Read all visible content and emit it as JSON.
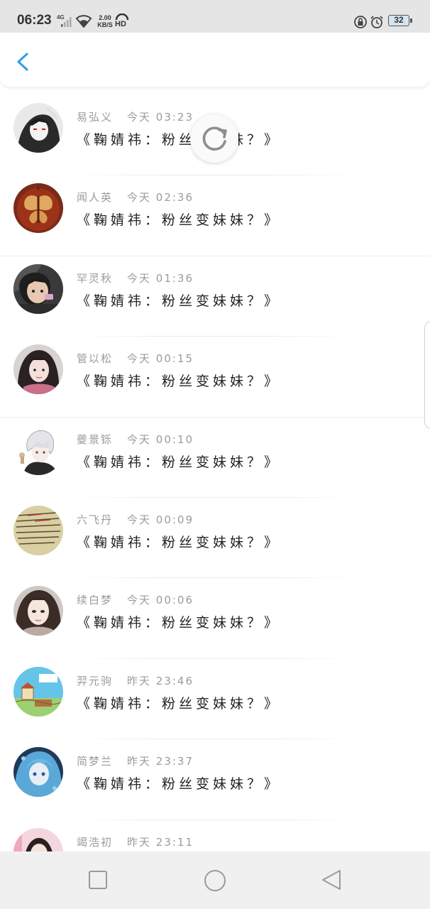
{
  "status_bar": {
    "time": "06:23",
    "network_label": "4G",
    "speed_value": "2.00",
    "speed_unit": "KB/S",
    "hd_label": "HD",
    "battery": "32"
  },
  "header": {
    "back_icon": "chevron-left-icon",
    "accent_color": "#2aa0e8"
  },
  "refresh": {
    "icon": "refresh-icon"
  },
  "comments": [
    {
      "name": "易弘义",
      "time": "今天 03:23",
      "text": "《鞠婧祎：粉丝变妹妹？》",
      "avatar": "avatar-1"
    },
    {
      "name": "闻人英",
      "time": "今天 02:36",
      "text": "《鞠婧祎：粉丝变妹妹？》",
      "avatar": "avatar-2"
    },
    {
      "name": "罕灵秋",
      "time": "今天 01:36",
      "text": "《鞠婧祎：粉丝变妹妹？》",
      "avatar": "avatar-3"
    },
    {
      "name": "管以松",
      "time": "今天 00:15",
      "text": "《鞠婧祎：粉丝变妹妹？》",
      "avatar": "avatar-4"
    },
    {
      "name": "夔景铄",
      "time": "今天 00:10",
      "text": "《鞠婧祎：粉丝变妹妹？》",
      "avatar": "avatar-5"
    },
    {
      "name": "六飞丹",
      "time": "今天 00:09",
      "text": "《鞠婧祎：粉丝变妹妹？》",
      "avatar": "avatar-6"
    },
    {
      "name": "续白梦",
      "time": "今天 00:06",
      "text": "《鞠婧祎：粉丝变妹妹？》",
      "avatar": "avatar-7"
    },
    {
      "name": "羿元驹",
      "time": "昨天 23:46",
      "text": "《鞠婧祎：粉丝变妹妹？》",
      "avatar": "avatar-8"
    },
    {
      "name": "简梦兰",
      "time": "昨天 23:37",
      "text": "《鞠婧祎：粉丝变妹妹？》",
      "avatar": "avatar-9"
    },
    {
      "name": "竭浩初",
      "time": "昨天 23:11",
      "text": "",
      "avatar": "avatar-10"
    }
  ],
  "nav_bar": {
    "recents_icon": "square-icon",
    "home_icon": "circle-icon",
    "back_icon": "triangle-back-icon"
  }
}
